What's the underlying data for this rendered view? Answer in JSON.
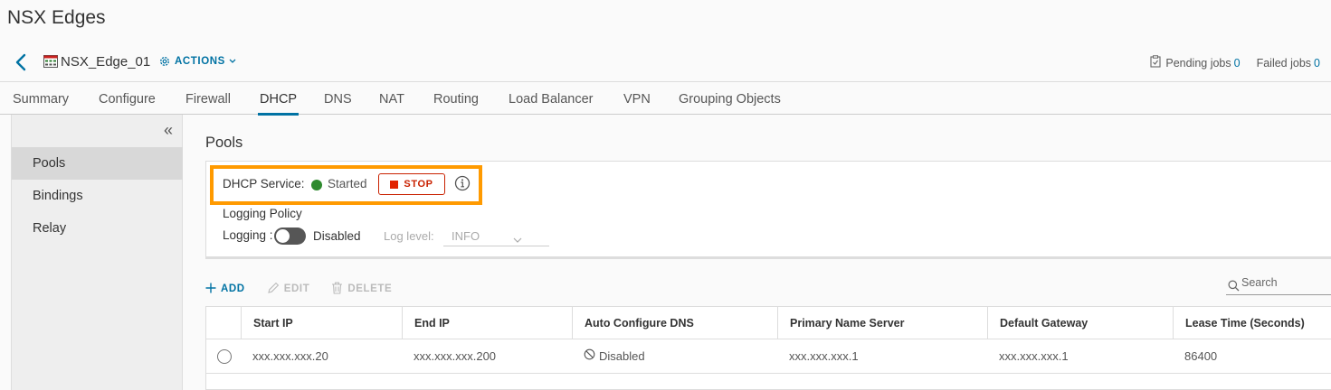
{
  "page": {
    "title": "NSX Edges"
  },
  "edge": {
    "name": "NSX_Edge_01",
    "actions_label": "ACTIONS",
    "pending_jobs_label": "Pending jobs",
    "pending_jobs_count": "0",
    "failed_jobs_label": "Failed jobs",
    "failed_jobs_count": "0"
  },
  "tabs": [
    {
      "label": "Summary"
    },
    {
      "label": "Configure"
    },
    {
      "label": "Firewall"
    },
    {
      "label": "DHCP",
      "active": true
    },
    {
      "label": "DNS"
    },
    {
      "label": "NAT"
    },
    {
      "label": "Routing"
    },
    {
      "label": "Load Balancer"
    },
    {
      "label": "VPN"
    },
    {
      "label": "Grouping Objects"
    }
  ],
  "sidebar": {
    "collapse_glyph": "«",
    "items": [
      {
        "label": "Pools",
        "active": true
      },
      {
        "label": "Bindings"
      },
      {
        "label": "Relay"
      }
    ]
  },
  "pools": {
    "title": "Pools",
    "service_label": "DHCP Service:",
    "service_status": "Started",
    "status_color": "#2e8a2e",
    "stop_label": "STOP",
    "logging_policy_title": "Logging Policy",
    "logging_label": "Logging :",
    "logging_state": "Disabled",
    "log_level_label": "Log level:",
    "log_level_value": "INFO"
  },
  "toolbar": {
    "add_label": "ADD",
    "edit_label": "EDIT",
    "delete_label": "DELETE",
    "search_placeholder": "Search"
  },
  "table": {
    "columns": [
      "Start IP",
      "End IP",
      "Auto Configure DNS",
      "Primary Name Server",
      "Default Gateway",
      "Lease Time (Seconds)"
    ],
    "rows": [
      {
        "start_ip": "xxx.xxx.xxx.20",
        "end_ip": "xxx.xxx.xxx.200",
        "auto_dns": "Disabled",
        "primary_ns": "xxx.xxx.xxx.1",
        "gateway": "xxx.xxx.xxx.1",
        "lease_time": "86400"
      }
    ]
  },
  "colors": {
    "accent": "#0072a3",
    "highlight": "#ff9a00",
    "stop": "#c92100"
  }
}
